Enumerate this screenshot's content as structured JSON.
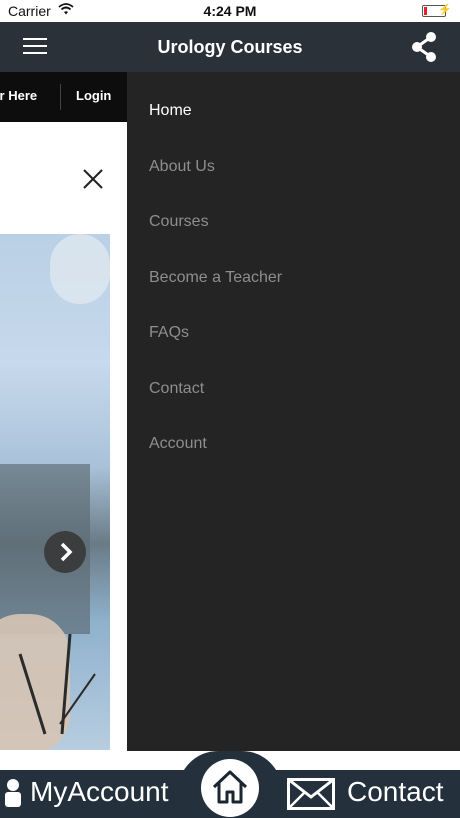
{
  "status_bar": {
    "carrier": "Carrier",
    "time": "4:24 PM"
  },
  "nav_bar": {
    "title": "Urology Courses"
  },
  "page": {
    "register_label": "ter Here",
    "login_label": "Login"
  },
  "drawer": {
    "items": [
      {
        "label": "Home"
      },
      {
        "label": "About Us"
      },
      {
        "label": "Courses"
      },
      {
        "label": "Become a Teacher"
      },
      {
        "label": "FAQs"
      },
      {
        "label": "Contact"
      },
      {
        "label": "Account"
      }
    ]
  },
  "tab_bar": {
    "myaccount_label": "MyAccount",
    "contact_label": "Contact"
  },
  "colors": {
    "nav": "#2a3139",
    "drawer": "#242424",
    "tab_bar": "#24313c",
    "active_item": "#ffffff",
    "inactive_item": "#8e8e8e"
  }
}
